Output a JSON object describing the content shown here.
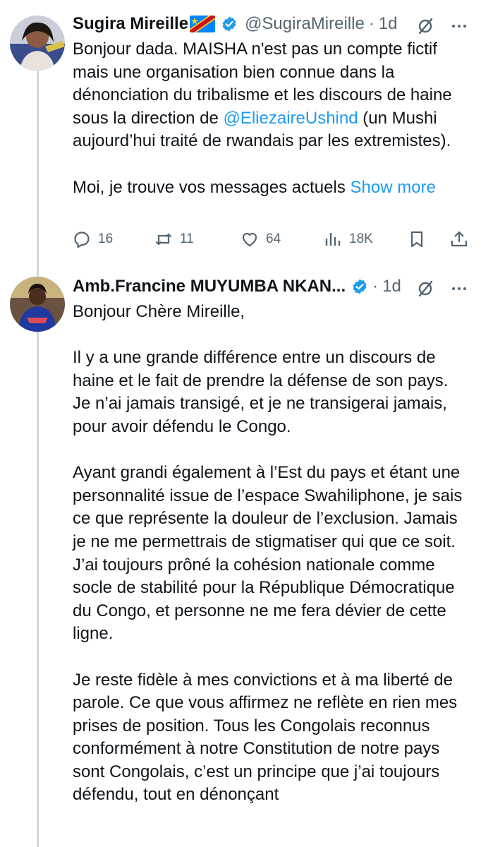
{
  "tweet1": {
    "name": "Sugira Mireille",
    "handle": "@SugiraMireille",
    "dot": "·",
    "time": "1d",
    "paragraph1_pre": "Bonjour dada. MAISHA n'est pas un compte fictif mais une organisation bien connue dans la dénonciation du tribalisme et les discours de haine sous la direction de ",
    "mention": "@EliezaireUshind",
    "paragraph1_post": "  (un Mushi aujourd’hui traité de rwandais par les extremistes).",
    "paragraph2": "Moi, je trouve vos messages actuels ",
    "show_more": "Show more",
    "stats": {
      "replies": "16",
      "reposts": "11",
      "likes": "64",
      "views": "18K"
    }
  },
  "tweet2": {
    "name": "Amb.Francine MUYUMBA NKAN...",
    "dot": "·",
    "time": "1d",
    "greeting": "Bonjour Chère Mireille,",
    "paragraph1": "Il y a une grande différence entre un discours de haine et le fait de prendre la défense de son pays. Je n’ai jamais transigé, et je ne transigerai jamais, pour avoir défendu le Congo.",
    "paragraph2": "Ayant grandi également à l’Est du pays  et étant une personnalité issue de l’espace Swahiliphone, je sais ce que représente la douleur de l’exclusion. Jamais je ne me permettrais de stigmatiser qui que ce soit. J’ai toujours prôné la cohésion nationale comme socle de stabilité pour la République Démocratique du Congo, et personne ne me fera dévier de cette ligne.",
    "paragraph3": "Je reste fidèle à mes convictions et à ma liberté de parole. Ce que vous affirmez ne reflète en rien mes prises de position. Tous les Congolais reconnus conformément à notre Constitution de notre pays  sont Congolais, c’est un principe que j’ai toujours défendu, tout en dénonçant"
  },
  "colors": {
    "link": "#1d9bf0",
    "verified": "#1d9bf0",
    "muted": "#536471",
    "thread_line": "#cfd9de"
  },
  "icons": [
    "drc-flag-icon",
    "verified-badge-icon",
    "grok-icon",
    "more-icon",
    "reply-icon",
    "repost-icon",
    "like-icon",
    "views-icon",
    "bookmark-icon",
    "share-icon"
  ]
}
